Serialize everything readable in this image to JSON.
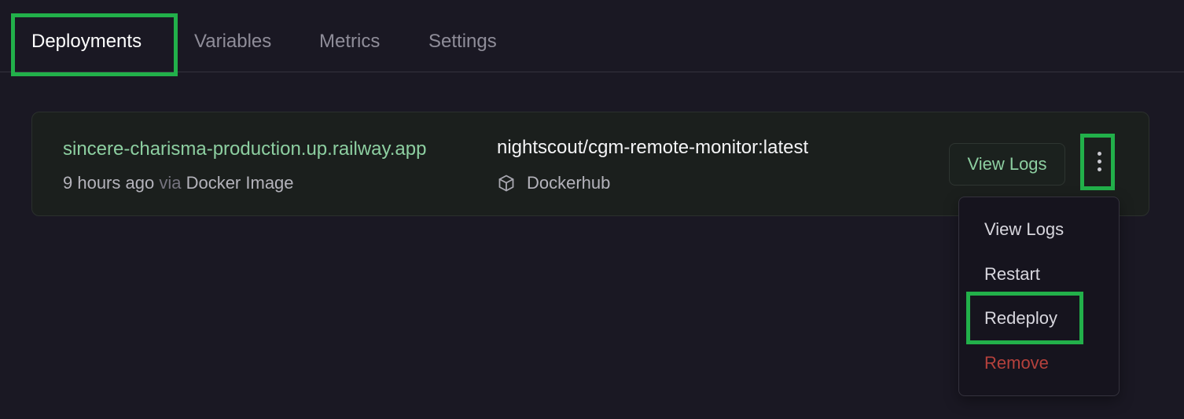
{
  "tabs": [
    {
      "label": "Deployments",
      "active": true
    },
    {
      "label": "Variables",
      "active": false
    },
    {
      "label": "Metrics",
      "active": false
    },
    {
      "label": "Settings",
      "active": false
    }
  ],
  "deployment": {
    "domain": "sincere-charisma-production.up.railway.app",
    "time_ago": "9 hours ago",
    "via_word": "via",
    "source": "Docker Image",
    "image": "nightscout/cgm-remote-monitor:latest",
    "registry_icon": "cube-icon",
    "registry": "Dockerhub",
    "view_logs_label": "View Logs",
    "more_icon": "more-vertical-icon"
  },
  "menu": {
    "items": [
      {
        "label": "View Logs"
      },
      {
        "label": "Restart"
      },
      {
        "label": "Redeploy"
      },
      {
        "label": "Remove"
      }
    ]
  },
  "colors": {
    "background": "#1a1823",
    "accent_green": "#8dcfa1",
    "highlight_box": "#22b04a",
    "danger": "#b5413c"
  }
}
